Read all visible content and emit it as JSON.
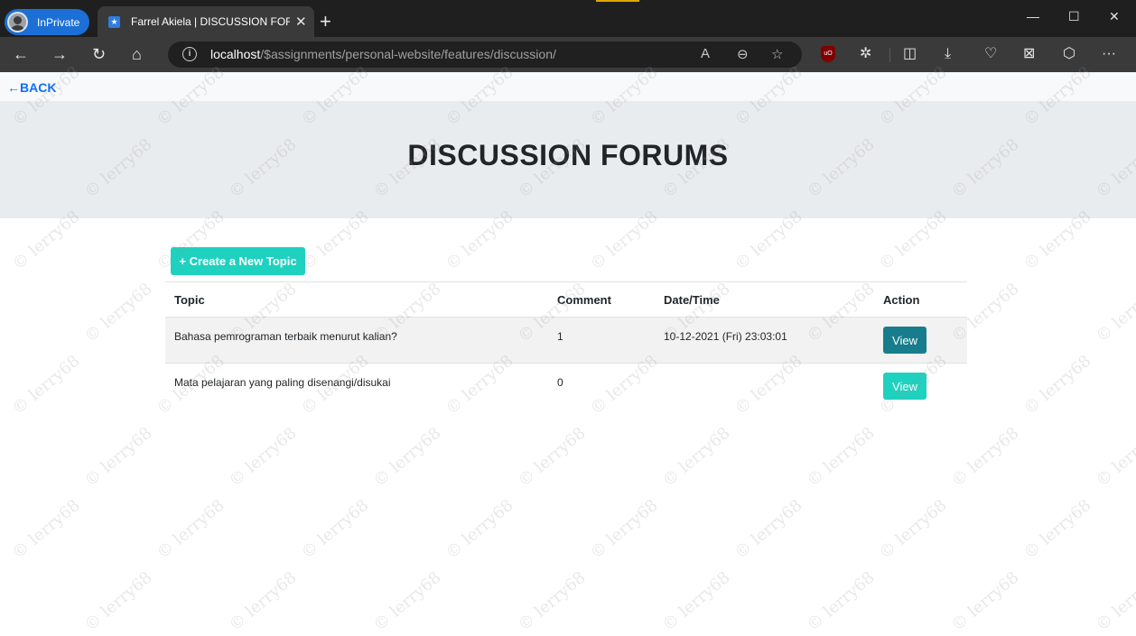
{
  "browser": {
    "profile_label": "InPrivate",
    "tab_title": "Farrel Akiela | DISCUSSION FORUMS",
    "url_host": "localhost",
    "url_path": "/$assignments/personal-website/features/discussion/"
  },
  "page": {
    "back_label": "←BACK",
    "heading": "DISCUSSION FORUMS",
    "create_button_label": "+ Create a New Topic"
  },
  "table": {
    "headers": [
      "Topic",
      "Comment",
      "Date/Time",
      "Action"
    ],
    "rows": [
      {
        "topic": "Bahasa pemrograman terbaik menurut kalian?",
        "comment": "1",
        "datetime": "10-12-2021 (Fri) 23:03:01",
        "action": "View"
      },
      {
        "topic": "Mata pelajaran yang paling disenangi/disukai",
        "comment": "0",
        "datetime": "",
        "action": "View"
      }
    ]
  },
  "watermark": "© lerry68",
  "colors": {
    "accent_teal": "#1fd1bf",
    "dark_teal": "#177d8c",
    "link_blue": "#0d6efd"
  }
}
